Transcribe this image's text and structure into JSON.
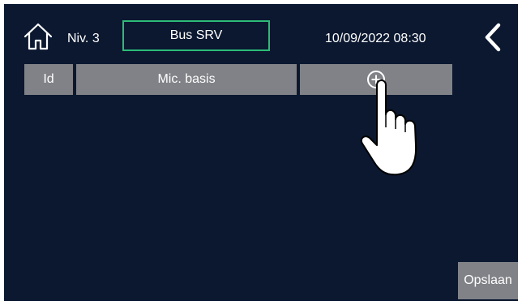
{
  "header": {
    "home_icon": "home-icon",
    "level_label": "Niv. 3",
    "bus_label": "Bus SRV",
    "datetime": "10/09/2022 08:30",
    "back_icon": "chevron-left-icon"
  },
  "table": {
    "columns": [
      "Id",
      "Mic. basis"
    ],
    "add_icon": "plus-circle-icon"
  },
  "footer": {
    "save_label": "Opslaan"
  },
  "colors": {
    "background": "#0b1830",
    "header_cell": "#808287",
    "accent_border": "#2dbb77",
    "text": "#ffffff"
  }
}
